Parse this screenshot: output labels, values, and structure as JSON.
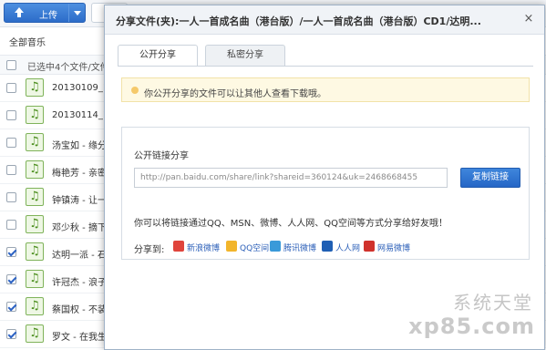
{
  "toolbar": {
    "upload_label": "上传"
  },
  "breadcrumb": "全部音乐",
  "list_header": {
    "selected_text": "已选中4个文件/文件"
  },
  "files": [
    {
      "name": "20130109_140",
      "checked": false
    },
    {
      "name": "20130114_140",
      "checked": false
    },
    {
      "name": "汤宝如 - 缘分",
      "checked": false
    },
    {
      "name": "梅艳芳 - 亲密",
      "checked": false
    },
    {
      "name": "钟镇涛 - 让一",
      "checked": false
    },
    {
      "name": "邓少秋 - 摘下",
      "checked": false
    },
    {
      "name": "达明一派 - 石",
      "checked": true
    },
    {
      "name": "许冠杰 - 浪子",
      "checked": true
    },
    {
      "name": "蔡国权 - 不装",
      "checked": true
    },
    {
      "name": "罗文 - 在我生",
      "checked": true
    }
  ],
  "dialog": {
    "title": "分享文件(夹):一人一首成名曲（港台版）/一人一首成名曲（港台版）CD1/达明...",
    "close_glyph": "×",
    "tabs": [
      {
        "label": "公开分享",
        "active": true
      },
      {
        "label": "私密分享",
        "active": false
      }
    ],
    "notice": "你公开分享的文件可以让其他人查看下载哦。",
    "public_link_label": "公开链接分享",
    "link_value": "http://pan.baidu.com/share/link?shareid=360124&uk=2468668455",
    "copy_button": "复制链接",
    "hint": "你可以将链接通过QQ、MSN、微博、人人网、QQ空间等方式分享给好友哦！",
    "share_to_label": "分享到:",
    "share_targets": [
      {
        "label": "新浪微博",
        "color": "#e0443c"
      },
      {
        "label": "QQ空间",
        "color": "#f2b52b"
      },
      {
        "label": "腾讯微博",
        "color": "#3a9ad9"
      },
      {
        "label": "人人网",
        "color": "#1f5fb4"
      },
      {
        "label": "网易微博",
        "color": "#d0322c"
      }
    ]
  },
  "watermark": {
    "line1": "系统天堂",
    "line2": "xp85.com"
  }
}
